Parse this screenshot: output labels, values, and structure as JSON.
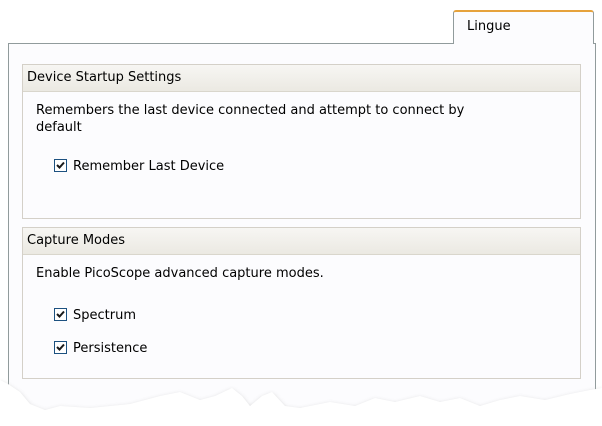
{
  "tab": {
    "label": "Lingue"
  },
  "device_startup": {
    "header": "Device Startup Settings",
    "description": "Remembers the last device connected and attempt to connect by default",
    "checkboxes": [
      {
        "label": "Remember Last Device",
        "checked": true
      }
    ]
  },
  "capture_modes": {
    "header": "Capture Modes",
    "description": "Enable PicoScope advanced capture modes.",
    "checkboxes": [
      {
        "label": "Spectrum",
        "checked": true
      },
      {
        "label": "Persistence",
        "checked": true
      }
    ]
  },
  "colors": {
    "border": "#919b9c",
    "checkbox_border": "#1c5180",
    "tab_highlight": "#e6a23c",
    "panel_background": "#fcfcfe"
  },
  "icons": {
    "checkbox_checked": "checkmark-icon"
  }
}
